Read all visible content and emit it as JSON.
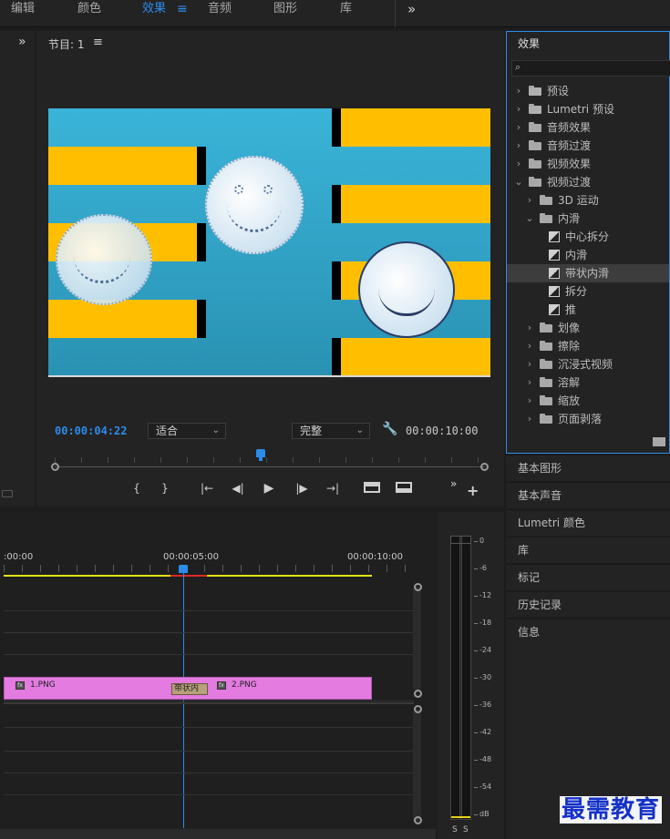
{
  "workspace_tabs": [
    "编辑",
    "颜色",
    "效果",
    "音频",
    "图形",
    "库"
  ],
  "active_tab_index": 2,
  "program_monitor": {
    "title": "节目: 1",
    "timecode_current": "00:00:04:22",
    "zoom_select": "适合",
    "quality_select": "完整",
    "timecode_duration": "00:00:10:00",
    "transport": [
      "{",
      "}",
      "|←",
      "◀|",
      "▶",
      "|▶",
      "→|"
    ]
  },
  "effects_panel": {
    "title": "效果",
    "search_placeholder": "",
    "tree": [
      {
        "label": "预设",
        "level": 0,
        "type": "star-folder",
        "expanded": false
      },
      {
        "label": "Lumetri 预设",
        "level": 0,
        "type": "star-folder",
        "expanded": false
      },
      {
        "label": "音频效果",
        "level": 0,
        "type": "folder",
        "expanded": false
      },
      {
        "label": "音频过渡",
        "level": 0,
        "type": "folder",
        "expanded": false
      },
      {
        "label": "视频效果",
        "level": 0,
        "type": "folder",
        "expanded": false
      },
      {
        "label": "视频过渡",
        "level": 0,
        "type": "folder",
        "expanded": true
      },
      {
        "label": "3D 运动",
        "level": 1,
        "type": "folder",
        "expanded": false
      },
      {
        "label": "内滑",
        "level": 1,
        "type": "folder",
        "expanded": true
      },
      {
        "label": "中心拆分",
        "level": 2,
        "type": "effect"
      },
      {
        "label": "内滑",
        "level": 2,
        "type": "effect"
      },
      {
        "label": "带状内滑",
        "level": 2,
        "type": "effect",
        "selected": true
      },
      {
        "label": "拆分",
        "level": 2,
        "type": "effect"
      },
      {
        "label": "推",
        "level": 2,
        "type": "effect"
      },
      {
        "label": "划像",
        "level": 1,
        "type": "folder",
        "expanded": false
      },
      {
        "label": "擦除",
        "level": 1,
        "type": "folder",
        "expanded": false
      },
      {
        "label": "沉浸式视频",
        "level": 1,
        "type": "folder",
        "expanded": false
      },
      {
        "label": "溶解",
        "level": 1,
        "type": "folder",
        "expanded": false
      },
      {
        "label": "缩放",
        "level": 1,
        "type": "folder",
        "expanded": false
      },
      {
        "label": "页面剥落",
        "level": 1,
        "type": "folder",
        "expanded": false
      }
    ]
  },
  "right_panels": [
    "基本图形",
    "基本声音",
    "Lumetri 颜色",
    "库",
    "标记",
    "历史记录",
    "信息"
  ],
  "timeline": {
    "ruler_labels": [
      ":00:00",
      "00:00:05:00",
      "00:00:10:00"
    ],
    "clip1_label": "1.PNG",
    "transition_label": "带状内",
    "clip2_label": "2.PNG"
  },
  "audio_meter": {
    "db_labels": [
      "0",
      "-6",
      "-12",
      "-18",
      "-24",
      "-30",
      "-36",
      "-42",
      "-48",
      "-54",
      "dB"
    ],
    "channel_labels": [
      "S",
      "S"
    ]
  },
  "watermark": "最需教育",
  "colors": {
    "accent": "#2d8ceb",
    "clip": "#e37be0",
    "yellow_bar": "#ffbf00",
    "video_bg": "#39b4d8"
  }
}
